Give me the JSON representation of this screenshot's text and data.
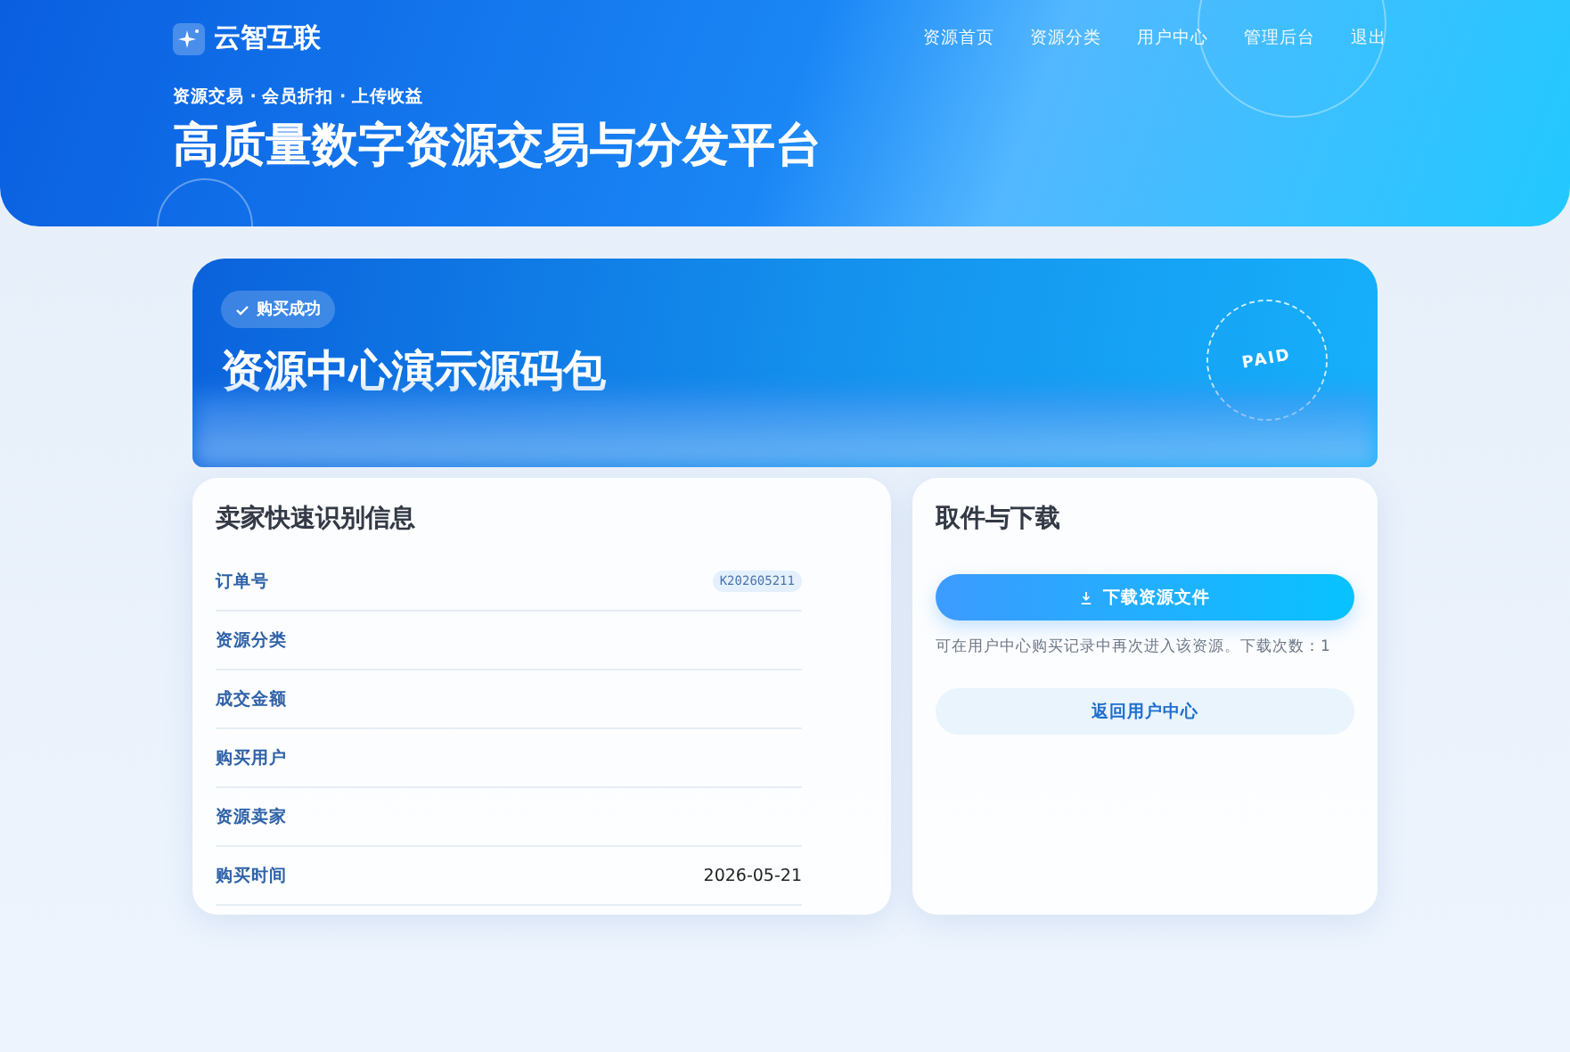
{
  "header": {
    "brand": "云智互联",
    "nav": [
      {
        "label": "资源首页",
        "selected": false
      },
      {
        "label": "资源分类",
        "selected": false
      },
      {
        "label": "用户中心",
        "selected": false
      },
      {
        "label": "管理后台",
        "selected": false
      },
      {
        "label": "退出",
        "selected": false
      }
    ],
    "tagline": "资源交易 · 会员折扣 · 上传收益",
    "headline": "高质量数字资源交易与分发平台"
  },
  "hero": {
    "badge": "购买成功",
    "title": "资源中心演示源码包",
    "stamp": "PAID"
  },
  "info_card": {
    "title": "卖家快速识别信息",
    "rows": [
      {
        "label": "订单号",
        "value": "K202605211",
        "kind": "chip"
      },
      {
        "label": "资源分类"
      },
      {
        "label": "成交金额"
      },
      {
        "label": "购买用户"
      },
      {
        "label": "资源卖家"
      },
      {
        "label": "购买时间",
        "value": "2026-05-21",
        "kind": "text"
      }
    ]
  },
  "download_card": {
    "title": "取件与下载",
    "download_button": "下载资源文件",
    "note": "可在用户中心购买记录中再次进入该资源。下载次数：1",
    "back_button": "返回用户中心"
  }
}
